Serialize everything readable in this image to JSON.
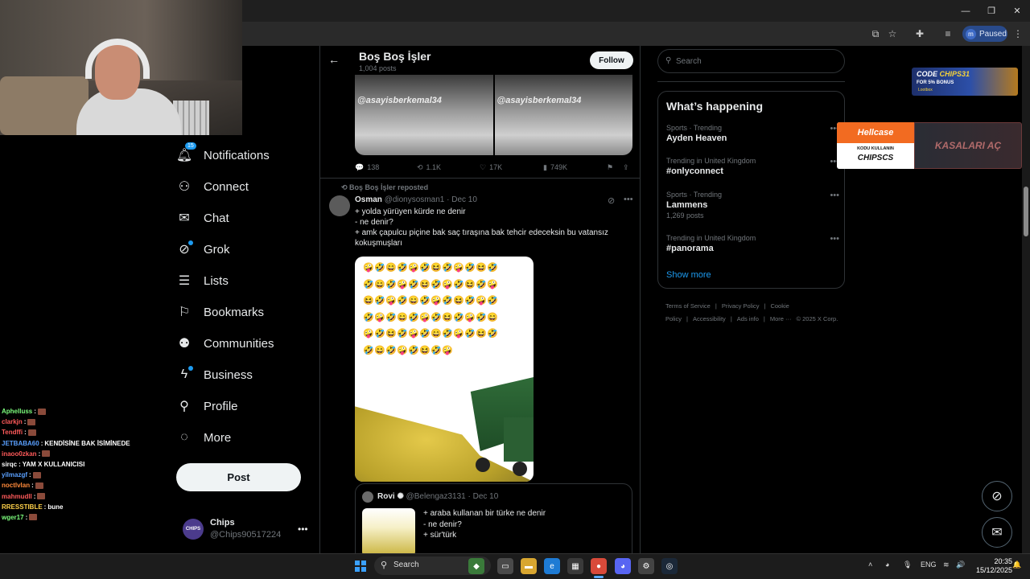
{
  "browser": {
    "profile_initial": "m",
    "profile_status": "Paused",
    "window_controls": [
      "—",
      "❐",
      "✕"
    ]
  },
  "chat": {
    "lines": [
      {
        "user": "Aphelluss",
        "color": "#7CFC7C",
        "msg": ""
      },
      {
        "user": "clarkjn",
        "color": "#ff5a5a",
        "msg": ""
      },
      {
        "user": "Tendffi",
        "color": "#ff5a5a",
        "msg": ""
      },
      {
        "user": "JETBABA60",
        "color": "#5aa0ff",
        "msg": "KENDİSİNE BAK İSİMİNEDE"
      },
      {
        "user": "inaoo0zkan",
        "color": "#ff5a5a",
        "msg": ""
      },
      {
        "user": "sirqc",
        "color": "#ffffff",
        "msg": "YAM X KULLANICISI"
      },
      {
        "user": "yilmazgf",
        "color": "#5aa0ff",
        "msg": ""
      },
      {
        "user": "noctlvlan",
        "color": "#ff8a3a",
        "msg": ""
      },
      {
        "user": "mahmudll",
        "color": "#ff5a5a",
        "msg": ""
      },
      {
        "user": "RRESSTIBLE",
        "color": "#ffd24a",
        "msg": "bune"
      },
      {
        "user": "wger17",
        "color": "#7CFC7C",
        "msg": ""
      }
    ]
  },
  "nav": {
    "notifications_badge": "15",
    "items": [
      {
        "key": "notifications",
        "label": "Notifications",
        "icon": "bell-icon"
      },
      {
        "key": "connect",
        "label": "Connect",
        "icon": "person-add-icon"
      },
      {
        "key": "chat",
        "label": "Chat",
        "icon": "mail-icon"
      },
      {
        "key": "grok",
        "label": "Grok",
        "icon": "grok-icon"
      },
      {
        "key": "lists",
        "label": "Lists",
        "icon": "list-icon"
      },
      {
        "key": "bookmarks",
        "label": "Bookmarks",
        "icon": "bookmark-icon"
      },
      {
        "key": "communities",
        "label": "Communities",
        "icon": "people-icon"
      },
      {
        "key": "business",
        "label": "Business",
        "icon": "lightning-icon"
      },
      {
        "key": "profile",
        "label": "Profile",
        "icon": "person-icon"
      },
      {
        "key": "more",
        "label": "More",
        "icon": "more-circle-icon"
      }
    ],
    "post_label": "Post",
    "account": {
      "name": "Chips",
      "handle": "@Chips90517224",
      "avatar_text": "CHIPS"
    }
  },
  "header": {
    "title": "Boş Boş İşler",
    "count": "1,004 posts",
    "follow_label": "Follow"
  },
  "top_post": {
    "watermark": "@asayisberkemal34",
    "replies": "138",
    "reposts": "1.1K",
    "likes": "17K",
    "views": "749K"
  },
  "tweet": {
    "repost_label": "Boş Boş İşler reposted",
    "name": "Osman",
    "handle": "@dionysosman1",
    "date": "Dec 10",
    "lines": [
      "+ yolda yürüyen kürde ne denir",
      "- ne denir?",
      "+ amk çapulcu piçine bak saç tıraşına bak tehcir edeceksin bu vatansız",
      "kokuşmuşları"
    ],
    "emoji_rows": [
      "🤪🤣😄🤣🤪🤣😆🤣🤪🤣😆🤣",
      "🤣😄🤣🤪🤣😆🤣🤪🤣😆🤣🤪",
      "😆🤣🤪🤣😄🤣🤪🤣😆🤣🤪🤣",
      "🤣🤪🤣😄🤣🤪🤣😆🤣🤪🤣😄",
      "🤪🤣😆🤣🤪🤣😄🤣🤪🤣😆🤣",
      "🤣😄🤣🤪🤣😆🤣🤪"
    ]
  },
  "quote": {
    "name": "Rovi ✺",
    "handle": "@Belengaz3131",
    "date": "Dec 10",
    "lines": [
      "+ araba kullanan bir türke ne denir",
      "- ne denir?",
      "+ sür'türk"
    ]
  },
  "right": {
    "search_placeholder": "Search",
    "trends_title": "What’s happening",
    "trends": [
      {
        "meta": "Sports · Trending",
        "name": "Ayden Heaven",
        "posts": ""
      },
      {
        "meta": "Trending in United Kingdom",
        "name": "#onlyconnect",
        "posts": ""
      },
      {
        "meta": "Sports · Trending",
        "name": "Lammens",
        "posts": "1,269 posts"
      },
      {
        "meta": "Trending in United Kingdom",
        "name": "#panorama",
        "posts": ""
      }
    ],
    "show_more": "Show more",
    "footer": [
      "Terms of Service",
      "|",
      "Privacy Policy",
      "|",
      "Cookie Policy",
      "|",
      "Accessibility",
      "|",
      "Ads info",
      "|",
      "More ···",
      "© 2025 X Corp."
    ]
  },
  "ads": {
    "code_line": "CODE",
    "code_value": "CHIPS31",
    "bonus": "FOR 5% BONUS",
    "lootbox": "Lootbox",
    "hellcase": "Hellcase",
    "kodu": "KODU KULLANIN",
    "chips": "CHIPSCS",
    "kasalari": "KASALARI AÇ"
  },
  "taskbar": {
    "search": "Search",
    "lang": "ENG",
    "time": "20:35",
    "date": "15/12/2025"
  }
}
